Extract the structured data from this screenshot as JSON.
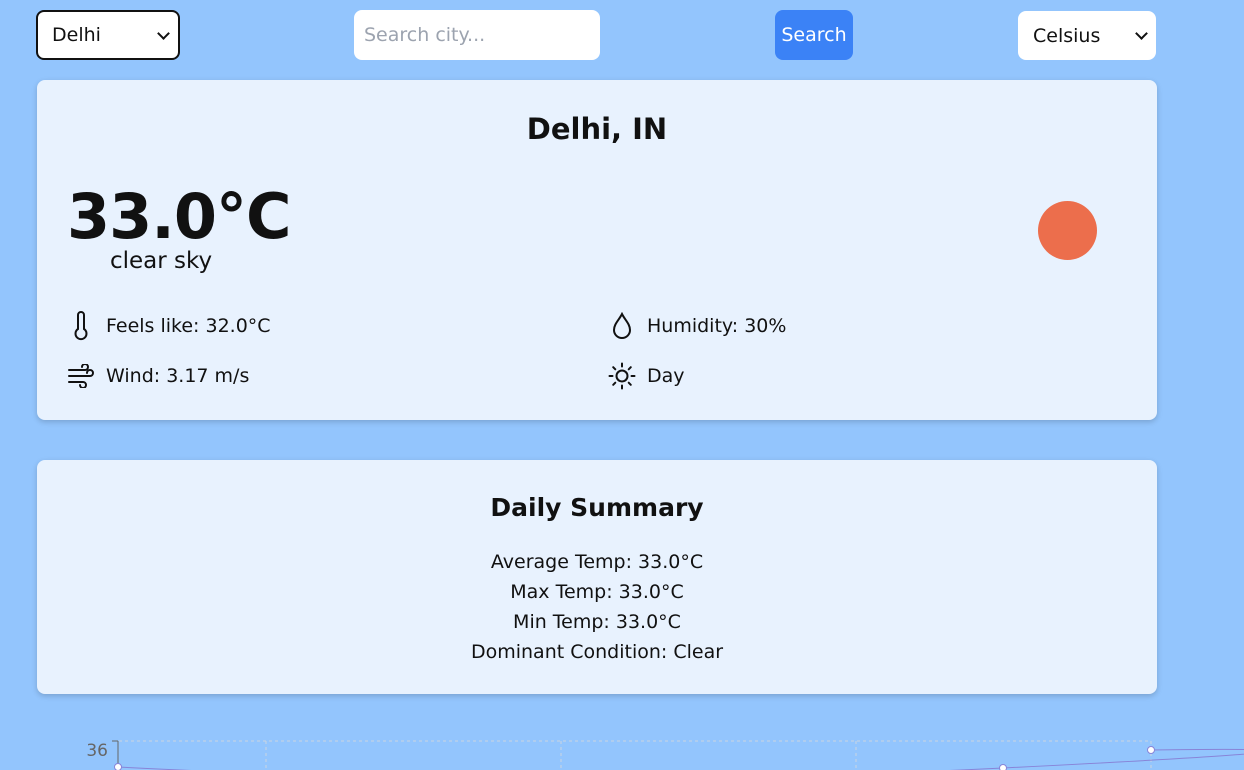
{
  "header": {
    "city_select_value": "Delhi",
    "search_placeholder": "Search city...",
    "search_label": "Search",
    "unit_select_value": "Celsius"
  },
  "current": {
    "location": "Delhi, IN",
    "temperature": "33.0°C",
    "description": "clear sky",
    "condition_icon_color": "#ec6e4c",
    "feels_like": "Feels like: 32.0°C",
    "humidity": "Humidity: 30%",
    "wind": "Wind: 3.17 m/s",
    "time_of_day": "Day"
  },
  "summary": {
    "title": "Daily Summary",
    "average": "Average Temp: 33.0°C",
    "max": "Max Temp: 33.0°C",
    "min": "Min Temp: 33.0°C",
    "dominant": "Dominant Condition: Clear"
  },
  "chart_data": {
    "type": "line",
    "y_tick_visible": "36",
    "line_color": "#8884d8",
    "grid": "dashed"
  }
}
